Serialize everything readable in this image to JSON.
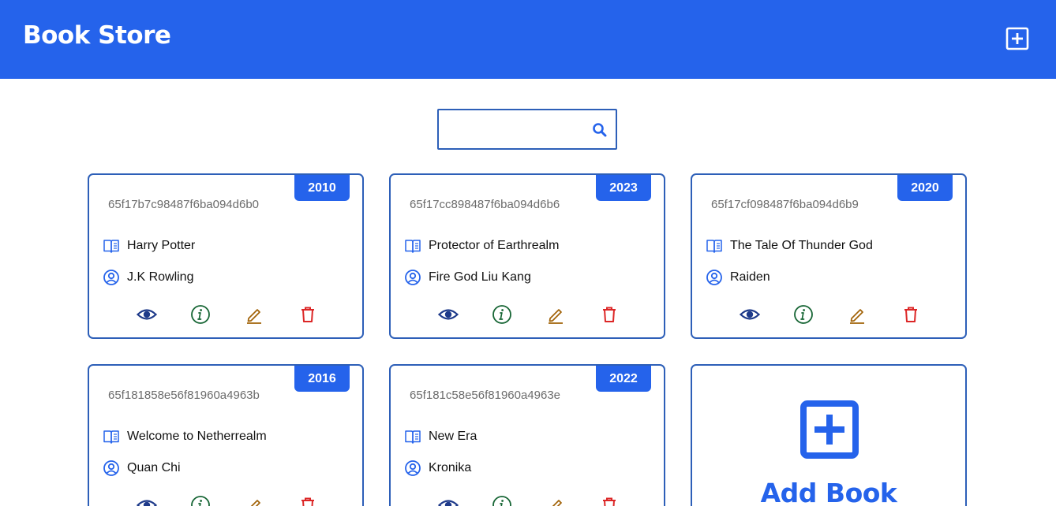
{
  "header": {
    "title": "Book Store",
    "add_icon": "plus-square-icon"
  },
  "search": {
    "value": "",
    "placeholder": "",
    "icon": "search-icon"
  },
  "books": [
    {
      "id": "65f17b7c98487f6ba094d6b0",
      "year": "2010",
      "title": "Harry Potter",
      "author": "J.K Rowling"
    },
    {
      "id": "65f17cc898487f6ba094d6b6",
      "year": "2023",
      "title": "Protector of Earthrealm",
      "author": "Fire God Liu Kang"
    },
    {
      "id": "65f17cf098487f6ba094d6b9",
      "year": "2020",
      "title": "The Tale Of Thunder God",
      "author": "Raiden"
    },
    {
      "id": "65f181858e56f81960a4963b",
      "year": "2016",
      "title": "Welcome to Netherrealm",
      "author": "Quan Chi"
    },
    {
      "id": "65f181c58e56f81960a4963e",
      "year": "2022",
      "title": "New Era",
      "author": "Kronika"
    }
  ],
  "add_card": {
    "label": "Add Book",
    "icon": "plus-square-icon"
  },
  "colors": {
    "primary": "#2563eb",
    "border": "#2d5fb8",
    "view": "#1e3a8a",
    "info": "#166534",
    "edit": "#a16207",
    "delete": "#dc2626"
  },
  "action_icons": [
    "eye-icon",
    "info-icon",
    "pencil-icon",
    "trash-icon"
  ]
}
